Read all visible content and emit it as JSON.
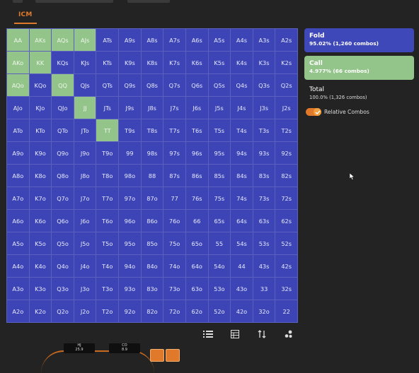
{
  "header": {
    "tab_label": "ICM"
  },
  "grid": {
    "call_hands": [
      "AA",
      "AKs",
      "AQs",
      "AJs",
      "AKo",
      "KK",
      "AQo",
      "QQ",
      "JJ",
      "TT"
    ],
    "rows": [
      [
        "AA",
        "AKs",
        "AQs",
        "AJs",
        "ATs",
        "A9s",
        "A8s",
        "A7s",
        "A6s",
        "A5s",
        "A4s",
        "A3s",
        "A2s"
      ],
      [
        "AKo",
        "KK",
        "KQs",
        "KJs",
        "KTs",
        "K9s",
        "K8s",
        "K7s",
        "K6s",
        "K5s",
        "K4s",
        "K3s",
        "K2s"
      ],
      [
        "AQo",
        "KQo",
        "QQ",
        "QJs",
        "QTs",
        "Q9s",
        "Q8s",
        "Q7s",
        "Q6s",
        "Q5s",
        "Q4s",
        "Q3s",
        "Q2s"
      ],
      [
        "AJo",
        "KJo",
        "QJo",
        "JJ",
        "JTs",
        "J9s",
        "J8s",
        "J7s",
        "J6s",
        "J5s",
        "J4s",
        "J3s",
        "J2s"
      ],
      [
        "ATo",
        "KTo",
        "QTo",
        "JTo",
        "TT",
        "T9s",
        "T8s",
        "T7s",
        "T6s",
        "T5s",
        "T4s",
        "T3s",
        "T2s"
      ],
      [
        "A9o",
        "K9o",
        "Q9o",
        "J9o",
        "T9o",
        "99",
        "98s",
        "97s",
        "96s",
        "95s",
        "94s",
        "93s",
        "92s"
      ],
      [
        "A8o",
        "K8o",
        "Q8o",
        "J8o",
        "T8o",
        "98o",
        "88",
        "87s",
        "86s",
        "85s",
        "84s",
        "83s",
        "82s"
      ],
      [
        "A7o",
        "K7o",
        "Q7o",
        "J7o",
        "T7o",
        "97o",
        "87o",
        "77",
        "76s",
        "75s",
        "74s",
        "73s",
        "72s"
      ],
      [
        "A6o",
        "K6o",
        "Q6o",
        "J6o",
        "T6o",
        "96o",
        "86o",
        "76o",
        "66",
        "65s",
        "64s",
        "63s",
        "62s"
      ],
      [
        "A5o",
        "K5o",
        "Q5o",
        "J5o",
        "T5o",
        "95o",
        "85o",
        "75o",
        "65o",
        "55",
        "54s",
        "53s",
        "52s"
      ],
      [
        "A4o",
        "K4o",
        "Q4o",
        "J4o",
        "T4o",
        "94o",
        "84o",
        "74o",
        "64o",
        "54o",
        "44",
        "43s",
        "42s"
      ],
      [
        "A3o",
        "K3o",
        "Q3o",
        "J3o",
        "T3o",
        "93o",
        "83o",
        "73o",
        "63o",
        "53o",
        "43o",
        "33",
        "32s"
      ],
      [
        "A2o",
        "K2o",
        "Q2o",
        "J2o",
        "T2o",
        "92o",
        "82o",
        "72o",
        "62o",
        "52o",
        "42o",
        "32o",
        "22"
      ]
    ]
  },
  "actions": {
    "fold": {
      "name": "Fold",
      "stats": "95.02% (1,260 combos)"
    },
    "call": {
      "name": "Call",
      "stats": "4.977% (66 combos)"
    },
    "total": {
      "name": "Total",
      "stats": "100.0% (1,326 combos)"
    }
  },
  "toggle": {
    "label": "Relative Combos",
    "on": true
  },
  "toolbar": {
    "icons": [
      "list-icon",
      "table-icon",
      "sort-icon",
      "scatter-icon"
    ]
  },
  "seats": [
    {
      "position": "HJ",
      "stack": "25.9"
    },
    {
      "position": "CO",
      "stack": "8.9"
    }
  ],
  "colors": {
    "fold": "#3d45b6",
    "call": "#93c48a",
    "accent": "#e07a2a",
    "background": "#232323"
  }
}
